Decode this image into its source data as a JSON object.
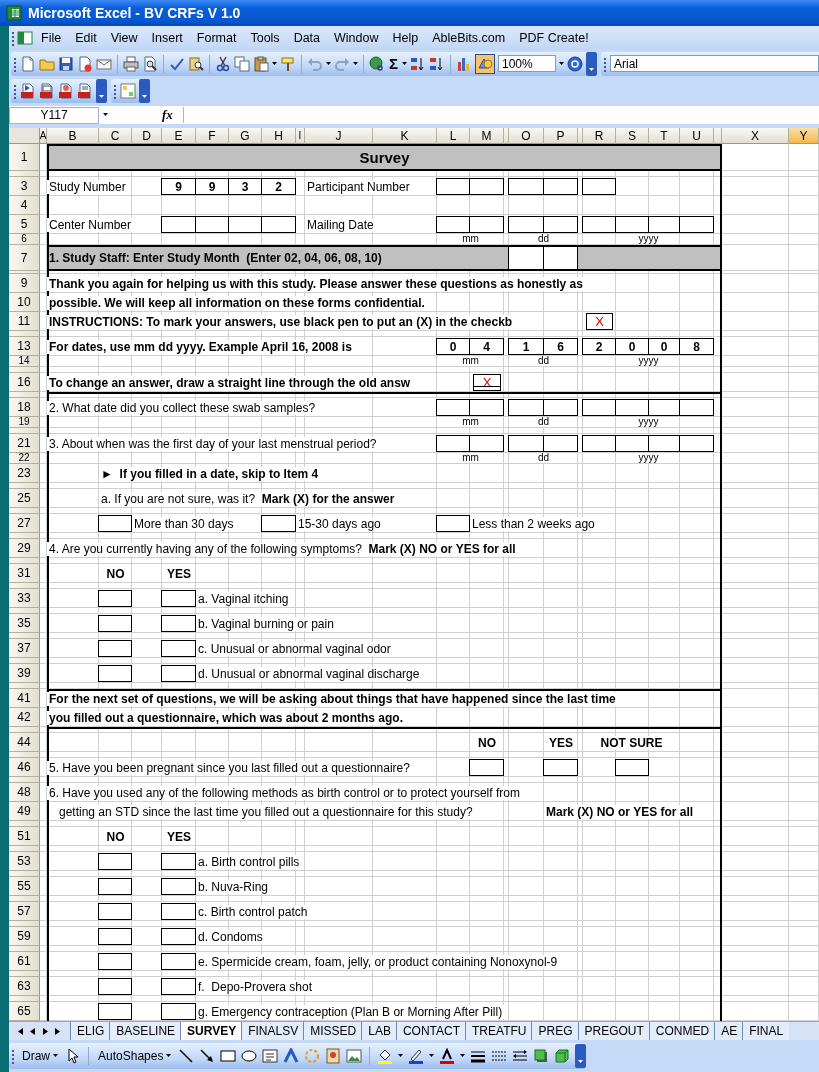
{
  "window": {
    "title": "Microsoft Excel - BV CRFs V 1.0"
  },
  "menu": [
    "File",
    "Edit",
    "View",
    "Insert",
    "Format",
    "Tools",
    "Data",
    "Window",
    "Help",
    "AbleBits.com",
    "PDF Create!"
  ],
  "toolbar": {
    "autosum": "Σ",
    "zoom": "100%",
    "font": "Arial"
  },
  "formula_bar": {
    "name_box": "Y117",
    "function_label": "fx"
  },
  "columns": [
    {
      "label": "A",
      "selected": false
    },
    {
      "label": "B",
      "selected": false
    },
    {
      "label": "C",
      "selected": false
    },
    {
      "label": "D",
      "selected": false
    },
    {
      "label": "E",
      "selected": false
    },
    {
      "label": "F",
      "selected": false
    },
    {
      "label": "G",
      "selected": false
    },
    {
      "label": "H",
      "selected": false
    },
    {
      "label": "I",
      "selected": false
    },
    {
      "label": "J",
      "selected": false
    },
    {
      "label": "K",
      "selected": false
    },
    {
      "label": "L",
      "selected": false
    },
    {
      "label": "M",
      "selected": false
    },
    {
      "selected": false
    },
    {
      "label": "O",
      "selected": false
    },
    {
      "label": "P",
      "selected": false
    },
    {
      "selected": false
    },
    {
      "label": "R",
      "selected": false
    },
    {
      "label": "S",
      "selected": false
    },
    {
      "label": "T",
      "selected": false
    },
    {
      "label": "U",
      "selected": false
    },
    {
      "selected": false
    },
    {
      "label": "X",
      "selected": false
    },
    {
      "label": "Y",
      "selected": true
    }
  ],
  "rows": [
    {
      "num": "1",
      "kind": "title",
      "cells": [
        {
          "kind": "title",
          "text": "Survey"
        }
      ]
    },
    {
      "kind": "spacer"
    },
    {
      "num": "3",
      "kind": "normal",
      "cells": [
        {
          "kind": "text",
          "text": "Study Number"
        },
        {
          "kind": "box",
          "text": "9"
        },
        {
          "kind": "box",
          "text": "9"
        },
        {
          "kind": "box",
          "text": "3"
        },
        {
          "kind": "box",
          "text": "2"
        },
        {
          "kind": "text",
          "text": "Participant Number"
        },
        {
          "kind": "box"
        },
        {
          "kind": "box"
        },
        {
          "kind": "box"
        },
        {
          "kind": "box"
        },
        {
          "kind": "box"
        }
      ]
    },
    {
      "num": "4",
      "kind": "normal"
    },
    {
      "num": "5",
      "kind": "normal",
      "cells": [
        {
          "kind": "text",
          "text": "Center Number"
        },
        {
          "kind": "box"
        },
        {
          "kind": "box"
        },
        {
          "kind": "box"
        },
        {
          "kind": "box"
        },
        {
          "kind": "text",
          "text": "Mailing Date"
        },
        {
          "kind": "box"
        },
        {
          "kind": "box"
        },
        {
          "kind": "box"
        },
        {
          "kind": "box"
        },
        {
          "kind": "box"
        },
        {
          "kind": "box"
        },
        {
          "kind": "box"
        },
        {
          "kind": "box"
        }
      ]
    },
    {
      "num": "6",
      "kind": "caption",
      "cells": [
        {
          "kind": "caption",
          "text": "mm"
        },
        {
          "kind": "caption",
          "text": "dd"
        },
        {
          "kind": "caption",
          "text": "yyyy"
        }
      ]
    },
    {
      "num": "7",
      "kind": "band",
      "cells": [
        {
          "kind": "text",
          "bold": true,
          "text": "1. Study Staff: Enter Study Month  (Enter 02, 04, 06, 08, 10)"
        },
        {
          "kind": "box"
        },
        {
          "kind": "box"
        }
      ]
    },
    {
      "kind": "thin"
    },
    {
      "num": "9",
      "kind": "normal",
      "cells": [
        {
          "kind": "text",
          "bold": true,
          "text": "Thank you again for helping us with this study. Please answer these questions as honestly as"
        }
      ]
    },
    {
      "num": "10",
      "kind": "normal",
      "cells": [
        {
          "kind": "text",
          "bold": true,
          "text": "possible. We will keep all information on these forms confidential."
        }
      ]
    },
    {
      "num": "11",
      "kind": "normal",
      "cells": [
        {
          "kind": "text",
          "bold": true,
          "text": "INSTRUCTIONS: To mark your answers, use black pen to put an (X) in the checkb"
        },
        {
          "kind": "sample",
          "text": "X",
          "struck": false
        }
      ]
    },
    {
      "kind": "spacer"
    },
    {
      "num": "13",
      "kind": "normal",
      "cells": [
        {
          "kind": "text",
          "bold": true,
          "text": "For dates, use mm dd yyyy. Example April 16, 2008 is"
        },
        {
          "kind": "box",
          "text": "0"
        },
        {
          "kind": "box",
          "text": "4"
        },
        {
          "kind": "box",
          "text": "1"
        },
        {
          "kind": "box",
          "text": "6"
        },
        {
          "kind": "box",
          "text": "2"
        },
        {
          "kind": "box",
          "text": "0"
        },
        {
          "kind": "box",
          "text": "0"
        },
        {
          "kind": "box",
          "text": "8"
        }
      ]
    },
    {
      "num": "14",
      "kind": "caption",
      "cells": [
        {
          "kind": "caption",
          "text": "mm"
        },
        {
          "kind": "caption",
          "text": "dd"
        },
        {
          "kind": "caption",
          "text": "yyyy"
        }
      ]
    },
    {
      "kind": "spacer"
    },
    {
      "num": "16",
      "kind": "normal",
      "cells": [
        {
          "kind": "text",
          "bold": true,
          "text": "To change an answer, draw a straight line through the old answ"
        },
        {
          "kind": "sample",
          "text": "X",
          "struck": true
        }
      ]
    },
    {
      "kind": "spacer"
    },
    {
      "num": "18",
      "kind": "normal",
      "cells": [
        {
          "kind": "text",
          "text": "2. What date did you collect these swab samples?"
        },
        {
          "kind": "box"
        },
        {
          "kind": "box"
        },
        {
          "kind": "box"
        },
        {
          "kind": "box"
        },
        {
          "kind": "box"
        },
        {
          "kind": "box"
        },
        {
          "kind": "box"
        },
        {
          "kind": "box"
        }
      ]
    },
    {
      "num": "19",
      "kind": "caption",
      "cells": [
        {
          "kind": "caption",
          "text": "mm"
        },
        {
          "kind": "caption",
          "text": "dd"
        },
        {
          "kind": "caption",
          "text": "yyyy"
        }
      ]
    },
    {
      "kind": "spacer"
    },
    {
      "num": "21",
      "kind": "normal",
      "cells": [
        {
          "kind": "text",
          "text": "3. About when was the first day of your last menstrual period?"
        },
        {
          "kind": "box"
        },
        {
          "kind": "box"
        },
        {
          "kind": "box"
        },
        {
          "kind": "box"
        },
        {
          "kind": "box"
        },
        {
          "kind": "box"
        },
        {
          "kind": "box"
        },
        {
          "kind": "box"
        }
      ]
    },
    {
      "num": "22",
      "kind": "caption",
      "cells": [
        {
          "kind": "caption",
          "text": "mm"
        },
        {
          "kind": "caption",
          "text": "dd"
        },
        {
          "kind": "caption",
          "text": "yyyy"
        }
      ]
    },
    {
      "num": "23",
      "kind": "normal",
      "cells": [
        {
          "kind": "text",
          "bold": true,
          "text": "►  If you filled in a date, skip to Item 4"
        }
      ]
    },
    {
      "kind": "spacer"
    },
    {
      "num": "25",
      "kind": "normal",
      "cells": [
        {
          "kind": "text",
          "text": "a. If you are not sure, was it?  **Mark (X) for the answer**"
        }
      ]
    },
    {
      "kind": "spacer"
    },
    {
      "num": "27",
      "kind": "normal",
      "cells": [
        {
          "kind": "checkbox",
          "checked": false
        },
        {
          "kind": "text",
          "text": "More than 30 days"
        },
        {
          "kind": "checkbox",
          "checked": false
        },
        {
          "kind": "text",
          "text": "15-30 days ago"
        },
        {
          "kind": "checkbox",
          "checked": false
        },
        {
          "kind": "text",
          "text": "Less than 2 weeks ago"
        }
      ]
    },
    {
      "kind": "spacer"
    },
    {
      "num": "29",
      "kind": "normal",
      "cells": [
        {
          "kind": "text",
          "text": "4. Are you currently having any of the following symptoms?  **Mark (X) NO or YES for all**"
        }
      ]
    },
    {
      "kind": "spacer"
    },
    {
      "num": "31",
      "kind": "normal",
      "cells": [
        {
          "kind": "heading",
          "text": "NO"
        },
        {
          "kind": "heading",
          "text": "YES"
        }
      ]
    },
    {
      "kind": "spacer"
    },
    {
      "num": "33",
      "kind": "normal",
      "cells": [
        {
          "kind": "checkbox",
          "checked": false
        },
        {
          "kind": "checkbox",
          "checked": false
        },
        {
          "kind": "text",
          "text": "a. Vaginal itching"
        }
      ]
    },
    {
      "kind": "spacer"
    },
    {
      "num": "35",
      "kind": "normal",
      "cells": [
        {
          "kind": "checkbox",
          "checked": false
        },
        {
          "kind": "checkbox",
          "checked": false
        },
        {
          "kind": "text",
          "text": "b. Vaginal burning or pain"
        }
      ]
    },
    {
      "kind": "spacer"
    },
    {
      "num": "37",
      "kind": "normal",
      "cells": [
        {
          "kind": "checkbox",
          "checked": false
        },
        {
          "kind": "checkbox",
          "checked": false
        },
        {
          "kind": "text",
          "text": "c. Unusual or abnormal vaginal odor"
        }
      ]
    },
    {
      "kind": "spacer"
    },
    {
      "num": "39",
      "kind": "normal",
      "cells": [
        {
          "kind": "checkbox",
          "checked": false
        },
        {
          "kind": "checkbox",
          "checked": false
        },
        {
          "kind": "text",
          "text": "d. Unusual or abnormal vaginal discharge"
        }
      ]
    },
    {
      "kind": "spacer"
    },
    {
      "num": "41",
      "kind": "normal",
      "cells": [
        {
          "kind": "text",
          "bold": true,
          "text": "For the next set of questions, we will be asking about things that have happened since the last time"
        }
      ]
    },
    {
      "num": "42",
      "kind": "normal",
      "cells": [
        {
          "kind": "text",
          "bold": true,
          "text": "you filled out a questionnaire, which was about 2 months ago."
        }
      ]
    },
    {
      "kind": "spacer"
    },
    {
      "num": "44",
      "kind": "normal",
      "cells": [
        {
          "kind": "heading",
          "text": "NO"
        },
        {
          "kind": "heading",
          "text": "YES"
        },
        {
          "kind": "heading",
          "text": "NOT SURE"
        }
      ]
    },
    {
      "kind": "spacer"
    },
    {
      "num": "46",
      "kind": "normal",
      "cells": [
        {
          "kind": "text",
          "text": "5. Have you been pregnant since you last filled out a questionnaire?"
        },
        {
          "kind": "checkbox",
          "checked": false
        },
        {
          "kind": "checkbox",
          "checked": false
        },
        {
          "kind": "checkbox",
          "checked": false
        }
      ]
    },
    {
      "kind": "spacer"
    },
    {
      "num": "48",
      "kind": "normal",
      "cells": [
        {
          "kind": "text",
          "text": "6. Have you used any of the following methods as birth control or to protect yourself from"
        }
      ]
    },
    {
      "num": "49",
      "kind": "normal",
      "cells": [
        {
          "kind": "text",
          "indent": true,
          "text": "getting an STD since the last time you filled out a questionnaire for this study?"
        },
        {
          "kind": "text",
          "bold": true,
          "text": "Mark (X) NO or YES for all"
        }
      ]
    },
    {
      "kind": "spacer"
    },
    {
      "num": "51",
      "kind": "normal",
      "cells": [
        {
          "kind": "heading",
          "text": "NO"
        },
        {
          "kind": "heading",
          "text": "YES"
        }
      ]
    },
    {
      "kind": "spacer"
    },
    {
      "num": "53",
      "kind": "normal",
      "cells": [
        {
          "kind": "checkbox",
          "checked": false
        },
        {
          "kind": "checkbox",
          "checked": false
        },
        {
          "kind": "text",
          "text": "a. Birth control pills"
        }
      ]
    },
    {
      "kind": "spacer"
    },
    {
      "num": "55",
      "kind": "normal",
      "cells": [
        {
          "kind": "checkbox",
          "checked": false
        },
        {
          "kind": "checkbox",
          "checked": false
        },
        {
          "kind": "text",
          "text": "b. Nuva-Ring"
        }
      ]
    },
    {
      "kind": "spacer"
    },
    {
      "num": "57",
      "kind": "normal",
      "cells": [
        {
          "kind": "checkbox",
          "checked": false
        },
        {
          "kind": "checkbox",
          "checked": false
        },
        {
          "kind": "text",
          "text": "c. Birth control patch"
        }
      ]
    },
    {
      "kind": "spacer"
    },
    {
      "num": "59",
      "kind": "normal",
      "cells": [
        {
          "kind": "checkbox",
          "checked": false
        },
        {
          "kind": "checkbox",
          "checked": false
        },
        {
          "kind": "text",
          "text": "d. Condoms"
        }
      ]
    },
    {
      "kind": "spacer"
    },
    {
      "num": "61",
      "kind": "normal",
      "cells": [
        {
          "kind": "checkbox",
          "checked": false
        },
        {
          "kind": "checkbox",
          "checked": false
        },
        {
          "kind": "text",
          "text": "e. Spermicide cream, foam, jelly, or product containing Nonoxynol-9"
        }
      ]
    },
    {
      "kind": "spacer"
    },
    {
      "num": "63",
      "kind": "normal",
      "cells": [
        {
          "kind": "checkbox",
          "checked": false
        },
        {
          "kind": "checkbox",
          "checked": false
        },
        {
          "kind": "text",
          "text": "f.  Depo-Provera shot"
        }
      ]
    },
    {
      "kind": "spacer"
    },
    {
      "num": "65",
      "kind": "normal",
      "cells": [
        {
          "kind": "checkbox",
          "checked": false
        },
        {
          "kind": "checkbox",
          "checked": false
        },
        {
          "kind": "text",
          "text": "g. Emergency contraception (Plan B or Morning After Pill)"
        }
      ]
    }
  ],
  "sheet_tabs": [
    {
      "label": "ELIG",
      "selected": false
    },
    {
      "label": "BASELINE",
      "selected": false
    },
    {
      "label": "SURVEY",
      "selected": true
    },
    {
      "label": "FINALSV",
      "selected": false
    },
    {
      "label": "MISSED",
      "selected": false
    },
    {
      "label": "LAB",
      "selected": false
    },
    {
      "label": "CONTACT",
      "selected": false
    },
    {
      "label": "TREATFU",
      "selected": false
    },
    {
      "label": "PREG",
      "selected": false
    },
    {
      "label": "PREGOUT",
      "selected": false
    },
    {
      "label": "CONMED",
      "selected": false
    },
    {
      "label": "AE",
      "selected": false
    },
    {
      "label": "FINAL",
      "selected": false
    }
  ],
  "drawing_toolbar": {
    "draw": "Draw",
    "autoshapes": "AutoShapes"
  }
}
